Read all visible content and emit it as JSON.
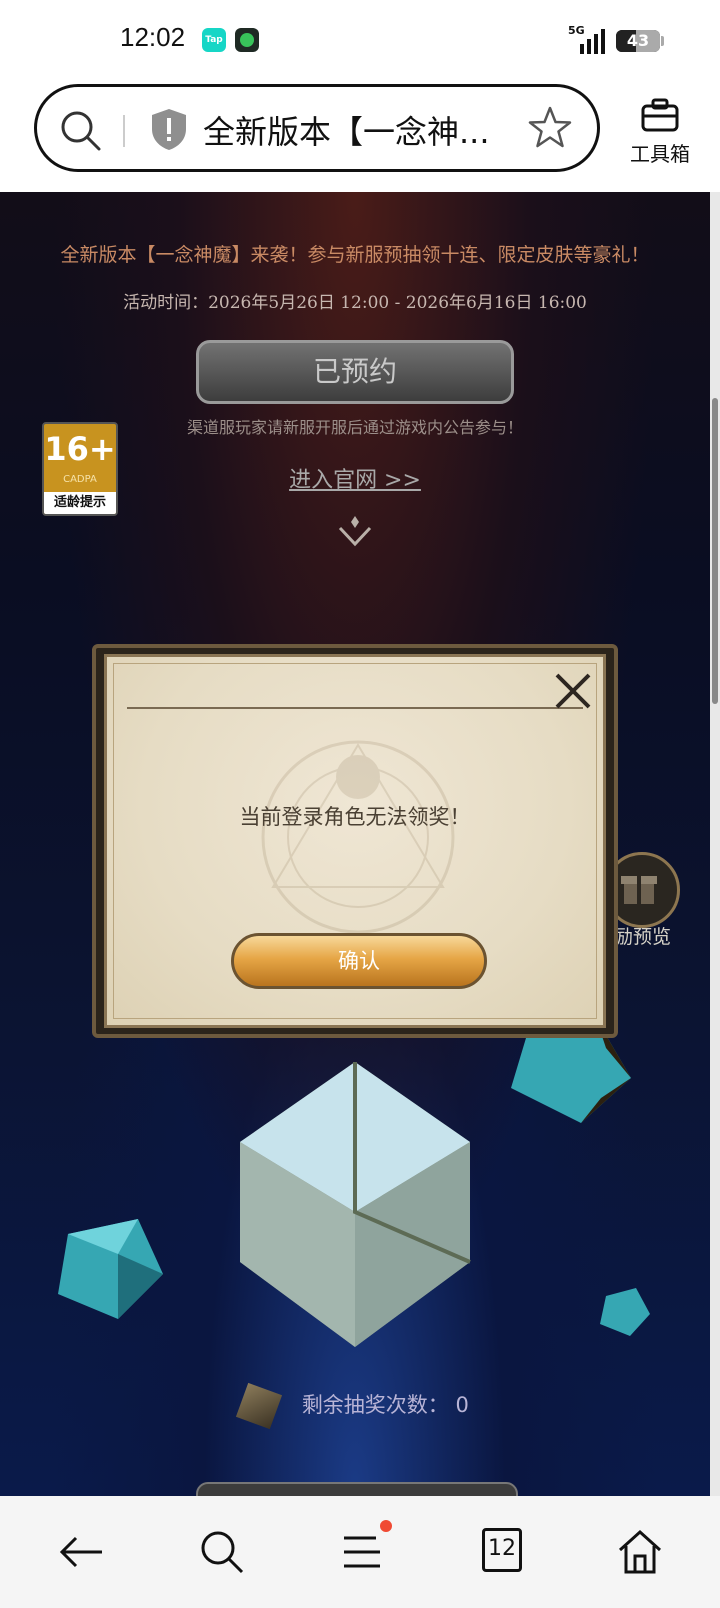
{
  "status_bar": {
    "time": "12:02",
    "app1_label": "Tap",
    "network": "5G",
    "battery": "43"
  },
  "address_bar": {
    "title": "全新版本【一念神...",
    "toolbox_label": "工具箱"
  },
  "event": {
    "banner": "全新版本【一念神魔】来袭！参与新服预抽领十连、限定皮肤等豪礼！",
    "event_time": "活动时间：2026年5月26日 12:00 - 2026年6月16日 16:00",
    "reserved_button": "已预约",
    "age_rating": "16+",
    "age_org": "CADPA",
    "age_tip": "适龄提示",
    "channel_note": "渠道服玩家请新服开服后通过游戏内公告参与！",
    "official_link": "进入官网 >>",
    "reward_preview_label": "励预览",
    "remaining_label": "剩余抽奖次数：",
    "remaining_count": "0"
  },
  "modal": {
    "message": "当前登录角色无法领奖！",
    "confirm_button": "确认"
  },
  "bottom_nav": {
    "tab_count": "12"
  },
  "colors": {
    "confirm_gold": "#e6a646",
    "modal_paper": "#efe6d4",
    "notification_dot": "#f04a33"
  }
}
